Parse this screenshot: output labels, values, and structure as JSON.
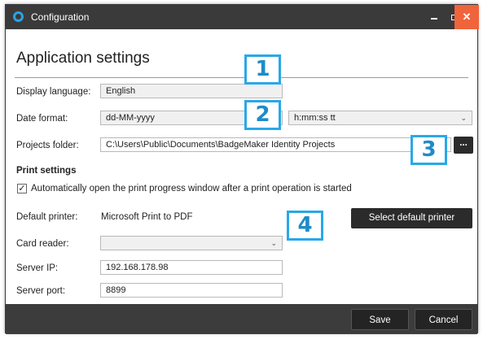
{
  "window": {
    "title": "Configuration",
    "close_glyph": "✕"
  },
  "page": {
    "heading": "Application settings"
  },
  "display_language": {
    "label": "Display language:",
    "value": "English"
  },
  "date_format": {
    "label": "Date format:",
    "date_value": "dd-MM-yyyy",
    "time_value": "h:mm:ss tt"
  },
  "projects_folder": {
    "label": "Projects folder:",
    "value": "C:\\Users\\Public\\Documents\\BadgeMaker Identity Projects",
    "browse_label": "..."
  },
  "print_settings": {
    "heading": "Print settings",
    "auto_open_label": "Automatically open the print progress window after a print operation is started",
    "auto_open_checked": true,
    "check_glyph": "✓",
    "default_printer_label": "Default printer:",
    "default_printer_value": "Microsoft Print to PDF",
    "select_printer_label": "Select default printer",
    "card_reader_label": "Card reader:",
    "card_reader_value": "",
    "server_ip_label": "Server IP:",
    "server_ip_value": "192.168.178.98",
    "server_port_label": "Server port:",
    "server_port_value": "8899"
  },
  "footer": {
    "save_label": "Save",
    "cancel_label": "Cancel"
  },
  "callouts": [
    "1",
    "2",
    "3",
    "4"
  ],
  "icons": {
    "app": "circle-logo-icon",
    "dropdown": "chevron-down-icon",
    "minimize": "minimize-icon",
    "maximize": "maximize-icon",
    "close": "close-icon"
  },
  "colors": {
    "titlebar": "#3a3a3a",
    "close": "#f0643c",
    "accent": "#29a8e8",
    "button": "#2b2b2b"
  }
}
